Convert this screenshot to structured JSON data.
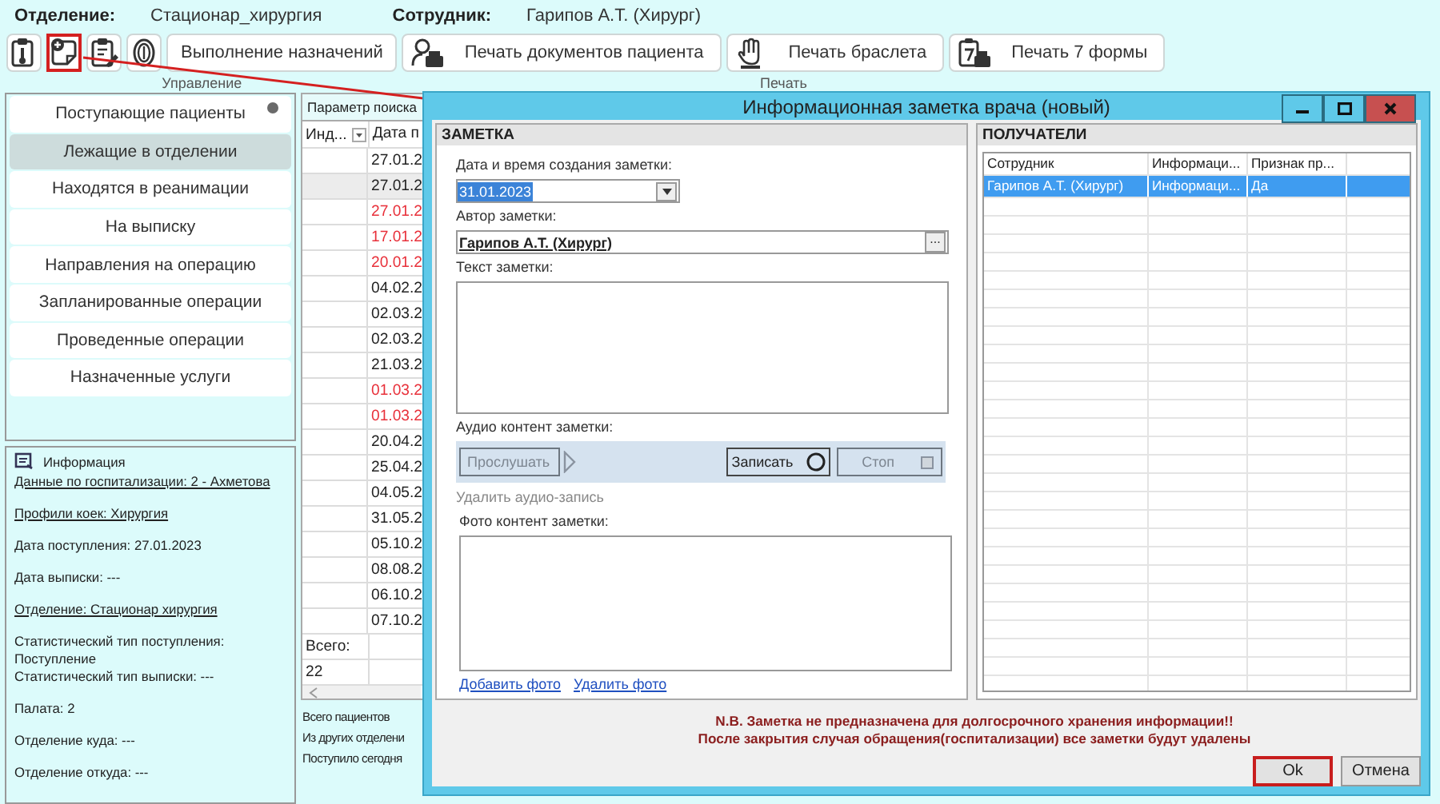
{
  "header": {
    "department_label": "Отделение:",
    "department": "Стационар_хирургия",
    "employee_label": "Сотрудник:",
    "employee": "Гарипов А.Т. (Хирург)"
  },
  "toolbar": [
    {
      "label": "Управление",
      "buttons": [
        {
          "kind": "icon",
          "highlighted": false
        },
        {
          "kind": "icon",
          "highlighted": true
        },
        {
          "kind": "icon",
          "highlighted": false
        },
        {
          "kind": "icon",
          "highlighted": false
        },
        {
          "kind": "text",
          "label": "Выполнение назначений",
          "highlighted": false
        }
      ]
    },
    {
      "label": "Печать",
      "buttons": [
        {
          "kind": "icon-text",
          "label": "Печать документов пациента",
          "highlighted": false
        },
        {
          "kind": "icon-text",
          "label": "Печать браслета",
          "highlighted": false
        },
        {
          "kind": "icon-text",
          "label": "Печать 7 формы",
          "highlighted": false
        }
      ]
    }
  ],
  "sidebar": {
    "items": [
      {
        "label": "Поступающие пациенты",
        "selected": false,
        "indicator": true
      },
      {
        "label": "Лежащие в отделении",
        "selected": true,
        "indicator": false
      },
      {
        "label": "Находятся в реанимации",
        "selected": false,
        "indicator": false
      },
      {
        "label": "На выписку",
        "selected": false,
        "indicator": false
      },
      {
        "label": "Направления на операцию",
        "selected": false,
        "indicator": false
      },
      {
        "label": "Запланированные операции",
        "selected": false,
        "indicator": false
      },
      {
        "label": "Проведенные операции",
        "selected": false,
        "indicator": false
      },
      {
        "label": "Назначенные услуги",
        "selected": false,
        "indicator": false
      }
    ]
  },
  "info": {
    "title": "Информация",
    "items": [
      {
        "link": true,
        "lines": [
          "Данные по госпитализации: 2 - Ахметова"
        ]
      },
      {
        "link": true,
        "lines": [
          "Профили коек: Хирургия"
        ]
      },
      {
        "link": false,
        "lines": [
          "Дата поступления: 27.01.2023"
        ]
      },
      {
        "link": false,
        "lines": [
          "Дата выписки: ---"
        ]
      },
      {
        "link": true,
        "lines": [
          "Отделение: Стационар хирургия"
        ]
      },
      {
        "link": false,
        "lines": [
          "Статистический тип поступления: Поступление",
          "Статистический тип выписки: ---"
        ]
      },
      {
        "link": false,
        "lines": [
          "Палата: 2"
        ]
      },
      {
        "link": false,
        "lines": [
          "Отделение куда: ---"
        ]
      },
      {
        "link": false,
        "lines": [
          "Отделение откуда: ---"
        ]
      }
    ]
  },
  "patients": {
    "tab": "Параметр поиска",
    "columns": [
      "Инд...",
      "Дата п"
    ],
    "rows": [
      {
        "date": "27.01.2",
        "color": "#222222",
        "selected": false
      },
      {
        "date": "27.01.2",
        "color": "#222222",
        "selected": true
      },
      {
        "date": "27.01.2",
        "color": "#e8303a",
        "selected": false
      },
      {
        "date": "17.01.2",
        "color": "#e8303a",
        "selected": false
      },
      {
        "date": "20.01.2",
        "color": "#e8303a",
        "selected": false
      },
      {
        "date": "04.02.2",
        "color": "#222222",
        "selected": false
      },
      {
        "date": "02.03.2",
        "color": "#222222",
        "selected": false
      },
      {
        "date": "02.03.2",
        "color": "#222222",
        "selected": false
      },
      {
        "date": "21.03.2",
        "color": "#222222",
        "selected": false
      },
      {
        "date": "01.03.2",
        "color": "#e8303a",
        "selected": false
      },
      {
        "date": "01.03.2",
        "color": "#e8303a",
        "selected": false
      },
      {
        "date": "20.04.2",
        "color": "#222222",
        "selected": false
      },
      {
        "date": "25.04.2",
        "color": "#222222",
        "selected": false
      },
      {
        "date": "04.05.2",
        "color": "#222222",
        "selected": false
      },
      {
        "date": "31.05.2",
        "color": "#222222",
        "selected": false
      },
      {
        "date": "05.10.2",
        "color": "#222222",
        "selected": false
      },
      {
        "date": "08.08.2",
        "color": "#222222",
        "selected": false
      },
      {
        "date": "06.10.2",
        "color": "#222222",
        "selected": false
      },
      {
        "date": "07.10.2",
        "color": "#222222",
        "selected": false
      }
    ],
    "total_label": "Всего:",
    "total": "22",
    "stats": [
      "Всего пациентов",
      "Из других отделени",
      "Поступило сегодня"
    ]
  },
  "dialog": {
    "title": "Информационная заметка врача (новый)",
    "note": {
      "heading": "ЗАМЕТКА",
      "date_label": "Дата и время создания заметки:",
      "date": "31.01.2023",
      "author_label": "Автор заметки:",
      "author": "Гарипов А.Т. (Хирург)",
      "author_button": "...",
      "text_label": "Текст заметки:",
      "audio_label": "Аудио контент заметки:",
      "audio_buttons": [
        {
          "label": "Прослушать",
          "kind": "play",
          "disabled": true
        },
        {
          "label": "Записать",
          "kind": "record",
          "disabled": false
        },
        {
          "label": "Стоп",
          "kind": "stop",
          "disabled": true
        }
      ],
      "delete_audio": {
        "label": "Удалить аудио-запись",
        "disabled": true
      },
      "photo_label": "Фото контент заметки:",
      "photo_links": [
        "Добавить фото",
        "Удалить фото"
      ]
    },
    "recipients": {
      "heading": "ПОЛУЧАТЕЛИ",
      "columns": [
        "Сотрудник",
        "Информаци...",
        "Признак пр..."
      ],
      "rows": [
        {
          "cells": [
            "Гарипов А.Т. (Хирург)",
            "Информаци...",
            "Да"
          ],
          "selected": true
        }
      ]
    },
    "warning": [
      "N.B. Заметка не предназначена для долгосрочного хранения информации!!",
      "После закрытия случая обращения(госпитализации) все заметки будут удалены"
    ],
    "buttons": [
      {
        "label": "Ok",
        "highlighted": true
      },
      {
        "label": "Отмена",
        "highlighted": false
      }
    ]
  }
}
